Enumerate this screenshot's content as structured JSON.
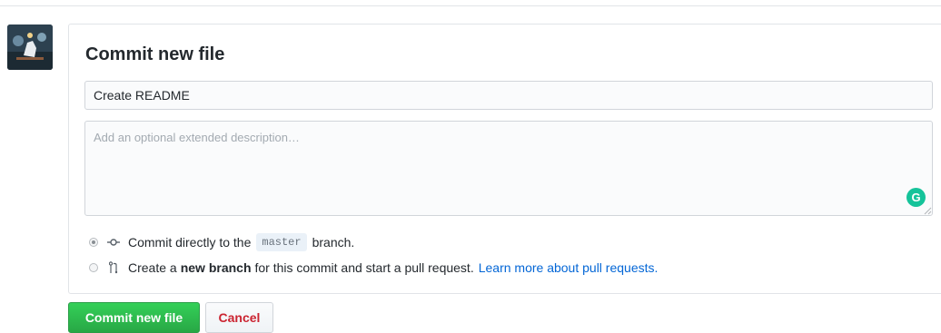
{
  "commit_form": {
    "title": "Commit new file",
    "summary_value": "Create README",
    "description_placeholder": "Add an optional extended description…",
    "options": {
      "direct": {
        "text_before": "Commit directly to the",
        "branch": "master",
        "text_after": "branch.",
        "selected": true
      },
      "new_branch": {
        "text_before": "Create a",
        "bold": "new branch",
        "text_after": "for this commit and start a pull request.",
        "link": "Learn more about pull requests.",
        "selected": false
      }
    }
  },
  "buttons": {
    "commit": "Commit new file",
    "cancel": "Cancel"
  },
  "grammarly_badge": "G",
  "icons": {
    "commit_option": "git-commit-icon",
    "branch_option": "git-pull-request-icon"
  },
  "colors": {
    "primary_button": "#28a745",
    "cancel_text": "#cb2431",
    "link": "#0366d6",
    "grammarly": "#15c39a"
  }
}
